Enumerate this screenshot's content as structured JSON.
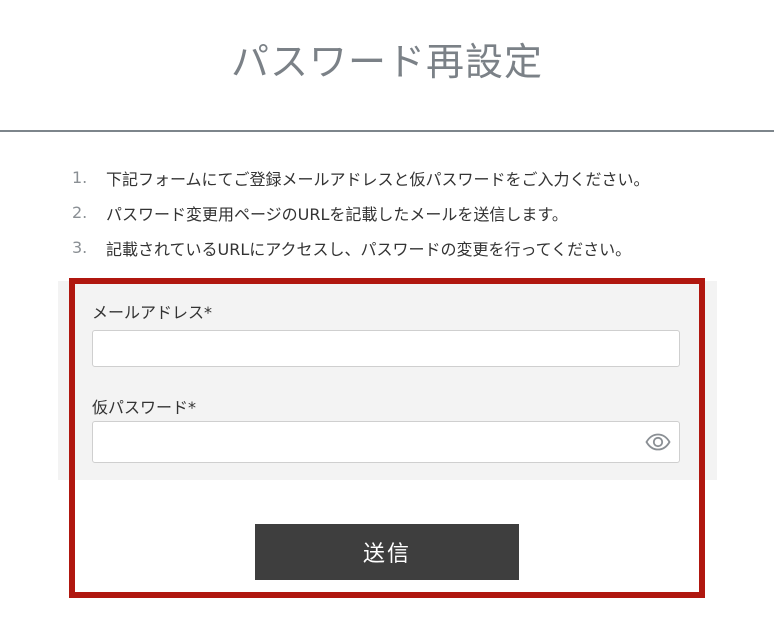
{
  "header": {
    "title": "パスワード再設定"
  },
  "instructions": [
    {
      "num": "1.",
      "text": "下記フォームにてご登録メールアドレスと仮パスワードをご入力ください。"
    },
    {
      "num": "2.",
      "text": "パスワード変更用ページのURLを記載したメールを送信します。"
    },
    {
      "num": "3.",
      "text": "記載されているURLにアクセスし、パスワードの変更を行ってください。"
    }
  ],
  "form": {
    "email_label": "メールアドレス*",
    "email_value": "",
    "email_placeholder": "",
    "password_label": "仮パスワード*",
    "password_value": "",
    "password_placeholder": "",
    "password_toggle_icon": "eye-icon",
    "submit_label": "送信"
  },
  "colors": {
    "title": "#7b8187",
    "divider": "#7d858b",
    "form_background": "#f3f3f3",
    "submit_button": "#3e3e3e",
    "highlight_frame": "#b0170f"
  }
}
